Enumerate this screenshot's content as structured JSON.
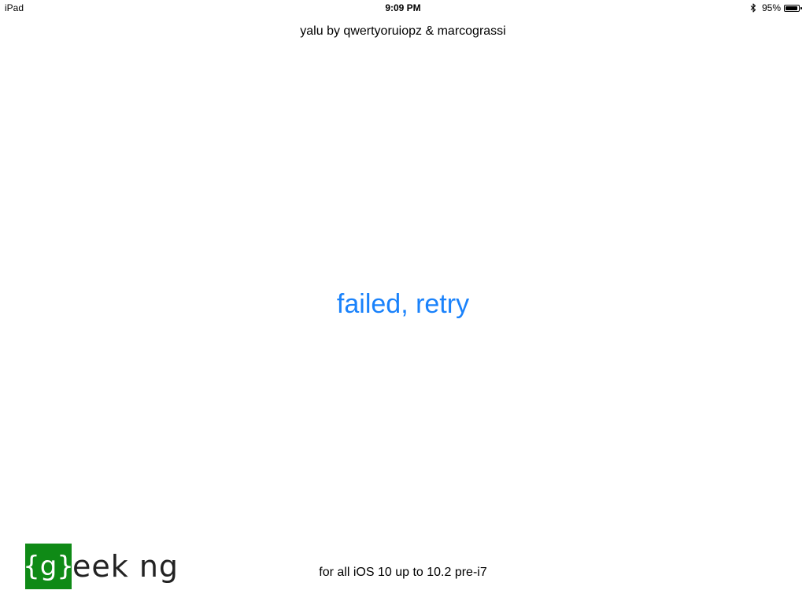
{
  "status_bar": {
    "device": "iPad",
    "time": "9:09 PM",
    "battery_percent": "95%",
    "battery_level": 0.95,
    "bluetooth_icon": "bluetooth-icon",
    "battery_icon": "battery-icon"
  },
  "app": {
    "credit": "yalu by qwertyoruiopz & marcograssi",
    "retry_label": "failed, retry",
    "footer": "for all iOS 10 up to 10.2 pre-i7"
  },
  "watermark": {
    "boxed": "{g}",
    "text": "eek ng"
  },
  "colors": {
    "accent": "#1a82fb",
    "watermark_green": "#0f8a16",
    "background": "#ffffff",
    "text": "#000000"
  }
}
